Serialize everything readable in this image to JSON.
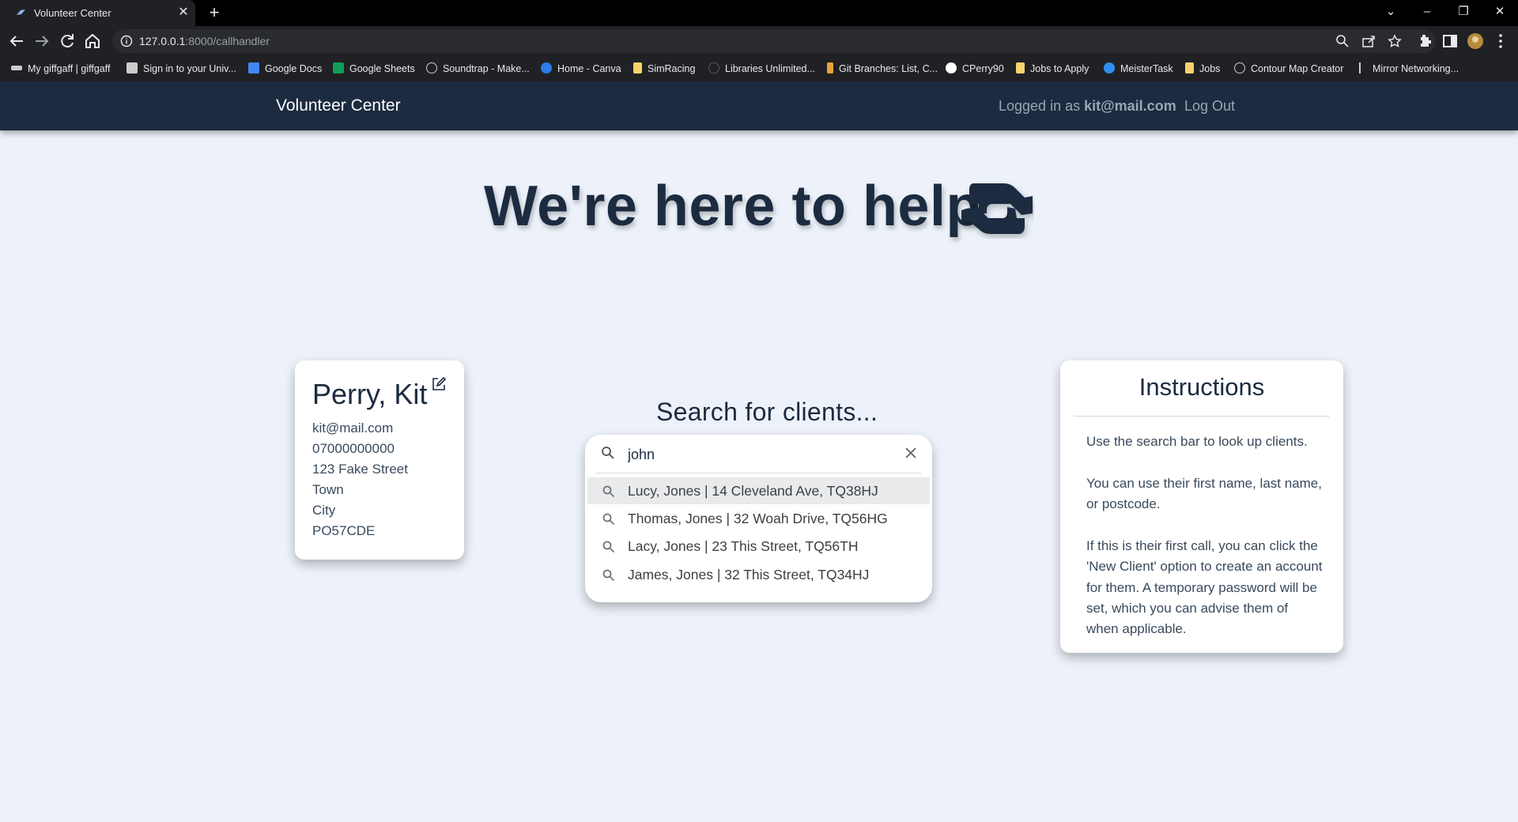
{
  "browser": {
    "tab_title": "Volunteer Center",
    "url_host": "127.0.0.1",
    "url_rest": ":8000/callhandler",
    "bookmarks": [
      {
        "label": "My giffgaff | giffgaff",
        "icon": "giffgaff-icon",
        "color": "#cccccc"
      },
      {
        "label": "Sign in to your Univ...",
        "icon": "university-icon",
        "color": "#cccccc"
      },
      {
        "label": "Google Docs",
        "icon": "google-docs-icon",
        "color": "#4285f4"
      },
      {
        "label": "Google Sheets",
        "icon": "google-sheets-icon",
        "color": "#0f9d58"
      },
      {
        "label": "Soundtrap - Make...",
        "icon": "soundtrap-icon",
        "color": "#cccccc"
      },
      {
        "label": "Home - Canva",
        "icon": "canva-icon",
        "color": "#2b7de9"
      },
      {
        "label": "SimRacing",
        "icon": "folder-icon",
        "color": "#f6d36b"
      },
      {
        "label": "Libraries Unlimited...",
        "icon": "libraries-icon",
        "color": "#555555"
      },
      {
        "label": "Git Branches: List, C...",
        "icon": "git-icon",
        "color": "#e8a33c"
      },
      {
        "label": "CPerry90",
        "icon": "github-icon",
        "color": "#ffffff"
      },
      {
        "label": "Jobs to Apply",
        "icon": "folder-icon",
        "color": "#f6d36b"
      },
      {
        "label": "MeisterTask",
        "icon": "meistertask-icon",
        "color": "#2f8ff0"
      },
      {
        "label": "Jobs",
        "icon": "folder-icon",
        "color": "#f6d36b"
      },
      {
        "label": "Contour Map Creator",
        "icon": "contour-icon",
        "color": "#cccccc"
      },
      {
        "label": "Mirror Networking...",
        "icon": "mirror-icon",
        "color": "#cccccc"
      }
    ]
  },
  "app": {
    "brand": "Volunteer Center",
    "logged_in_prefix": "Logged in as",
    "logged_in_user": "kit@mail.com",
    "logout_label": "Log Out",
    "hero_title": "We're here to help",
    "hero_icon": "handshake-icon",
    "colors": {
      "navbar": "#1c2b40",
      "background": "#edf2fa",
      "text": "#1c2b40"
    }
  },
  "user_card": {
    "name": "Perry, Kit",
    "email": "kit@mail.com",
    "phone": "07000000000",
    "street": "123 Fake Street",
    "town": "Town",
    "city": "City",
    "postcode": "PO57CDE"
  },
  "search": {
    "title": "Search for clients...",
    "query": "john",
    "suggestions": [
      "Lucy, Jones | 14 Cleveland Ave, TQ38HJ",
      "Thomas, Jones | 32 Woah Drive, TQ56HG",
      "Lacy, Jones | 23 This Street, TQ56TH",
      "James, Jones | 32 This Street, TQ34HJ"
    ]
  },
  "instructions": {
    "title": "Instructions",
    "p1": "Use the search bar to look up clients.",
    "p2": "You can use their first name, last name, or postcode.",
    "p3": "If this is their first call, you can click the 'New Client' option to create an account for them. A temporary password will be set, which you can advise them of when applicable."
  }
}
